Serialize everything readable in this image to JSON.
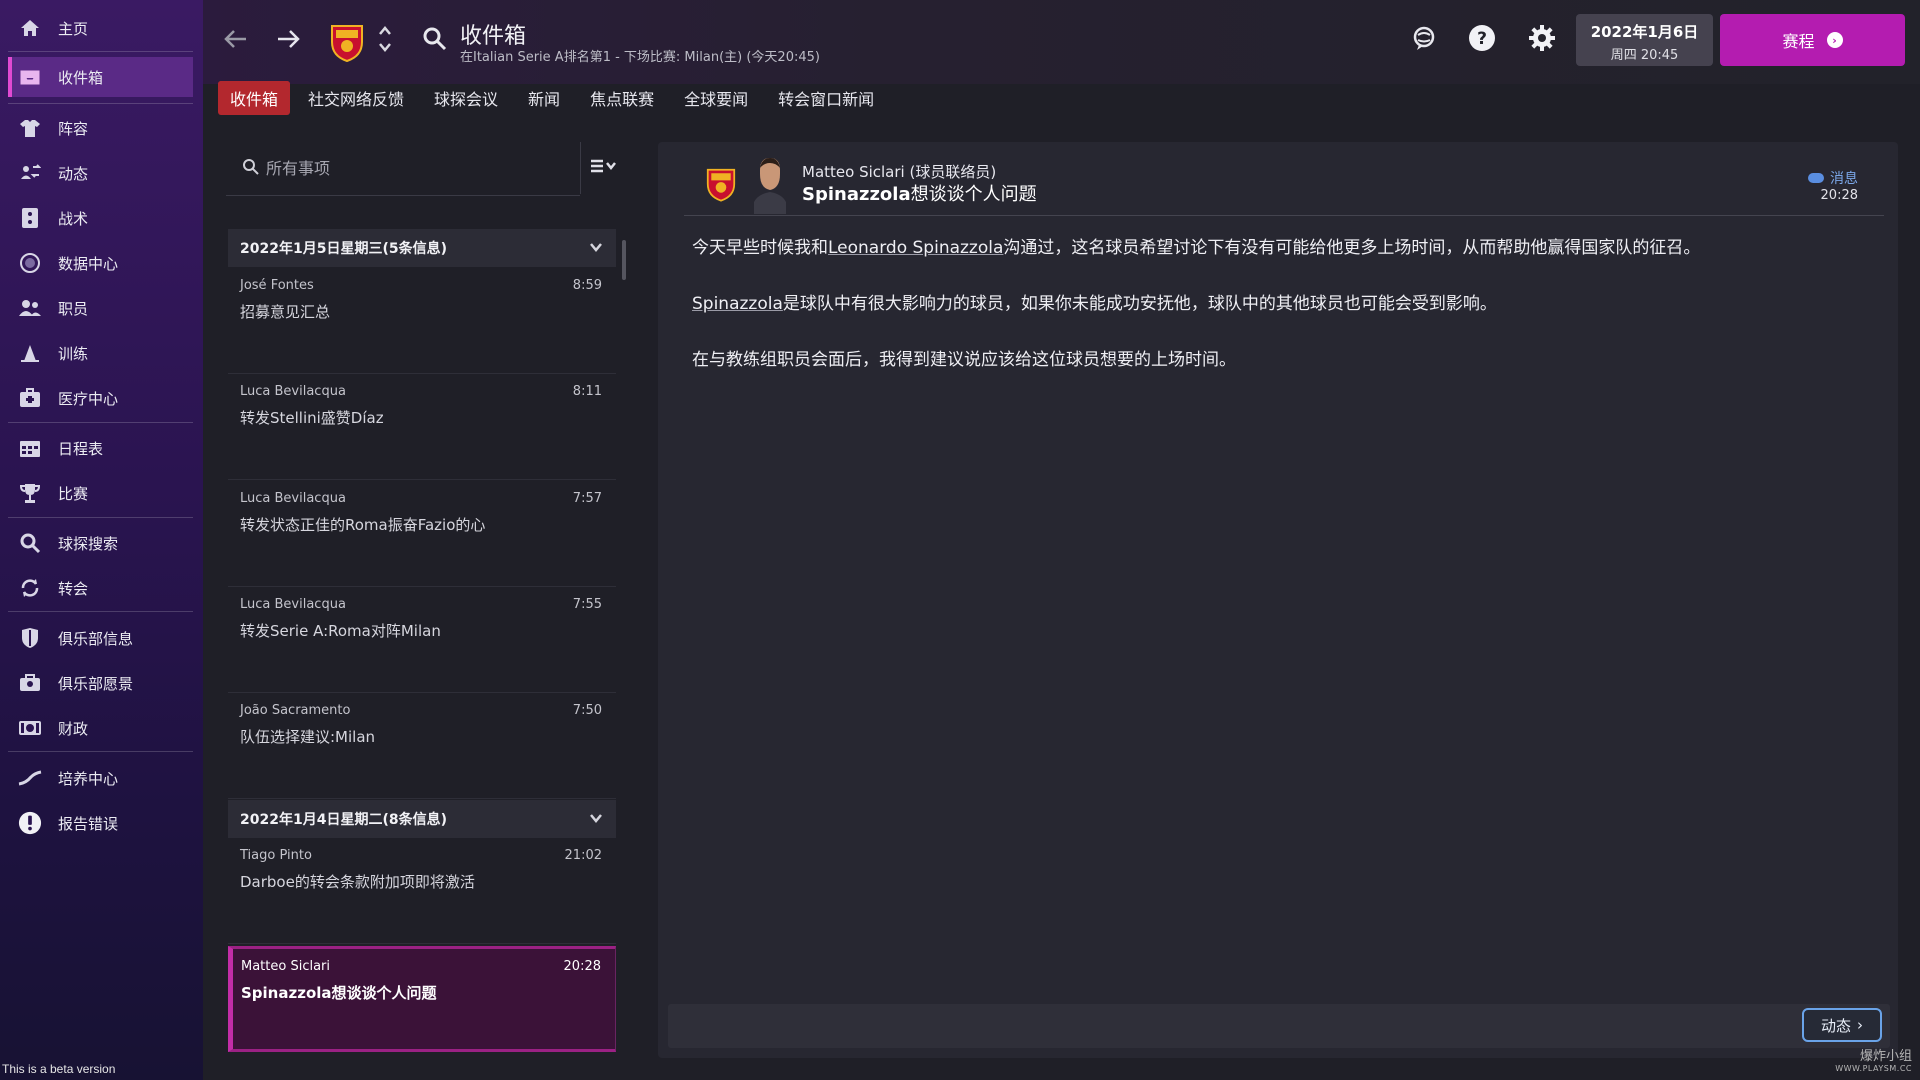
{
  "sidebar": {
    "items": [
      {
        "label": "主页",
        "icon": "home-icon"
      },
      {
        "label": "收件箱",
        "icon": "inbox-icon",
        "active": true
      },
      {
        "label": "阵容",
        "icon": "shirt-icon"
      },
      {
        "label": "动态",
        "icon": "dynamics-icon"
      },
      {
        "label": "战术",
        "icon": "tactics-icon"
      },
      {
        "label": "数据中心",
        "icon": "data-icon"
      },
      {
        "label": "职员",
        "icon": "staff-icon"
      },
      {
        "label": "训练",
        "icon": "training-icon"
      },
      {
        "label": "医疗中心",
        "icon": "medical-icon"
      },
      {
        "label": "日程表",
        "icon": "calendar-icon"
      },
      {
        "label": "比赛",
        "icon": "trophy-icon"
      },
      {
        "label": "球探搜索",
        "icon": "scouting-icon"
      },
      {
        "label": "转会",
        "icon": "transfer-icon"
      },
      {
        "label": "俱乐部信息",
        "icon": "shield-icon"
      },
      {
        "label": "俱乐部愿景",
        "icon": "vision-icon"
      },
      {
        "label": "财政",
        "icon": "finance-icon"
      },
      {
        "label": "培养中心",
        "icon": "development-icon"
      },
      {
        "label": "报告错误",
        "icon": "alert-icon"
      }
    ],
    "beta_text": "This is a beta version"
  },
  "header": {
    "title": "收件箱",
    "subtitle": "在Italian Serie A排名第1 - 下场比赛: Milan(主) (今天20:45)",
    "date": "2022年1月6日",
    "weekday_time": "周四 20:45",
    "continue_label": "赛程"
  },
  "tabs": [
    "收件箱",
    "社交网络反馈",
    "球探会议",
    "新闻",
    "焦点联赛",
    "全球要闻",
    "转会窗口新闻"
  ],
  "search": {
    "placeholder": "所有事项"
  },
  "groups": [
    {
      "title": "2022年1月5日星期三(5条信息)"
    },
    {
      "title": "2022年1月4日星期二(8条信息)"
    }
  ],
  "messages": [
    {
      "from": "José Fontes",
      "time": "8:59",
      "subject": "招募意见汇总"
    },
    {
      "from": "Luca Bevilacqua",
      "time": "8:11",
      "subject": "转发Stellini盛赞Díaz"
    },
    {
      "from": "Luca Bevilacqua",
      "time": "7:57",
      "subject": "转发状态正佳的Roma振奋Fazio的心"
    },
    {
      "from": "Luca Bevilacqua",
      "time": "7:55",
      "subject": "转发Serie A:Roma对阵Milan"
    },
    {
      "from": "João Sacramento",
      "time": "7:50",
      "subject": "队伍选择建议:Milan"
    },
    {
      "from": "Tiago Pinto",
      "time": "21:02",
      "subject": "Darboe的转会条款附加项即将激活"
    },
    {
      "from": "Matteo Siclari",
      "time": "20:28",
      "subject": "Spinazzola想谈谈个人问题"
    }
  ],
  "detail": {
    "sender": "Matteo Siclari (球员联络员)",
    "title_name": "Spinazzola",
    "title_rest": "想谈谈个人问题",
    "tag": "消息",
    "time": "20:28",
    "p1_a": "今天早些时候我和",
    "p1_link": "Leonardo Spinazzola",
    "p1_b": "沟通过，这名球员希望讨论下有没有可能给他更多上场时间，从而帮助他赢得国家队的征召。",
    "p2_link": "Spinazzola",
    "p2_b": "是球队中有很大影响力的球员，如果你未能成功安抚他，球队中的其他球员也可能会受到影响。",
    "p3": "在与教练组职员会面后，我得到建议说应该给这位球员想要的上场时间。"
  },
  "footer": {
    "dynamics_label": "动态"
  },
  "watermark": {
    "line1": "爆炸小组",
    "line2": "WWW.PLAYSM.CC"
  },
  "colors": {
    "accent": "#b41cb0",
    "tab_active": "#b3282e",
    "sidebar": "#2a1450"
  }
}
